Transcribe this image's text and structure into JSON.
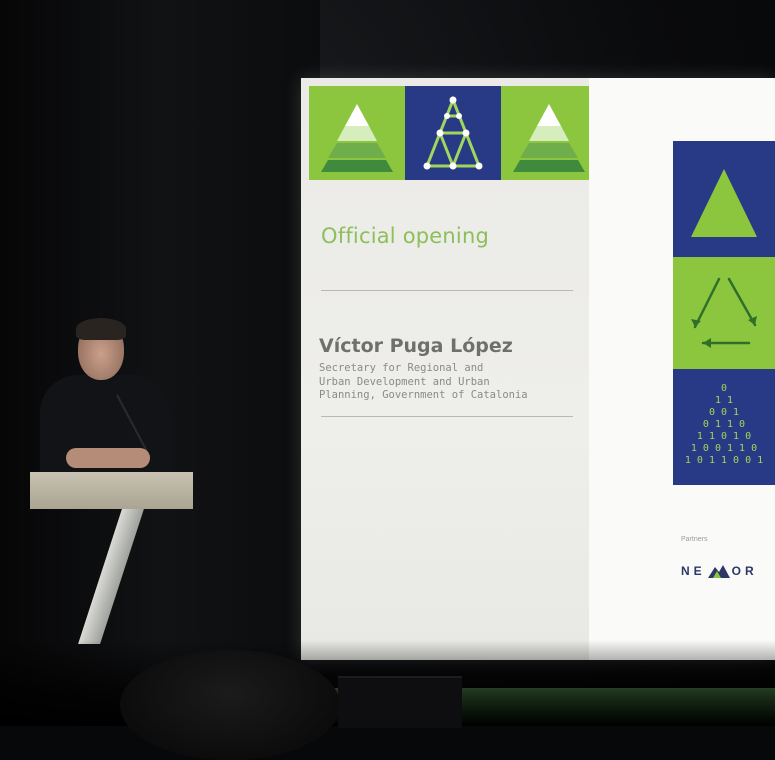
{
  "slide": {
    "title": "Official opening",
    "speaker_name": "Víctor Puga López",
    "speaker_role": "Secretary for Regional and\nUrban Development and Urban\nPlanning, Government of Catalonia",
    "partners_label": "Partners",
    "logo_text_left": "NE",
    "logo_text_right": "OR"
  },
  "colors": {
    "brand_green": "#8cc63f",
    "brand_blue": "#283a85",
    "title_green": "#8dbf5a"
  },
  "icons": {
    "top_tiles": [
      "layered-triangle-icon",
      "network-triangle-icon",
      "layered-triangle-icon"
    ],
    "side_tiles": [
      "solid-triangle-icon",
      "recycle-triangle-icon",
      "binary-triangle-icon"
    ]
  }
}
